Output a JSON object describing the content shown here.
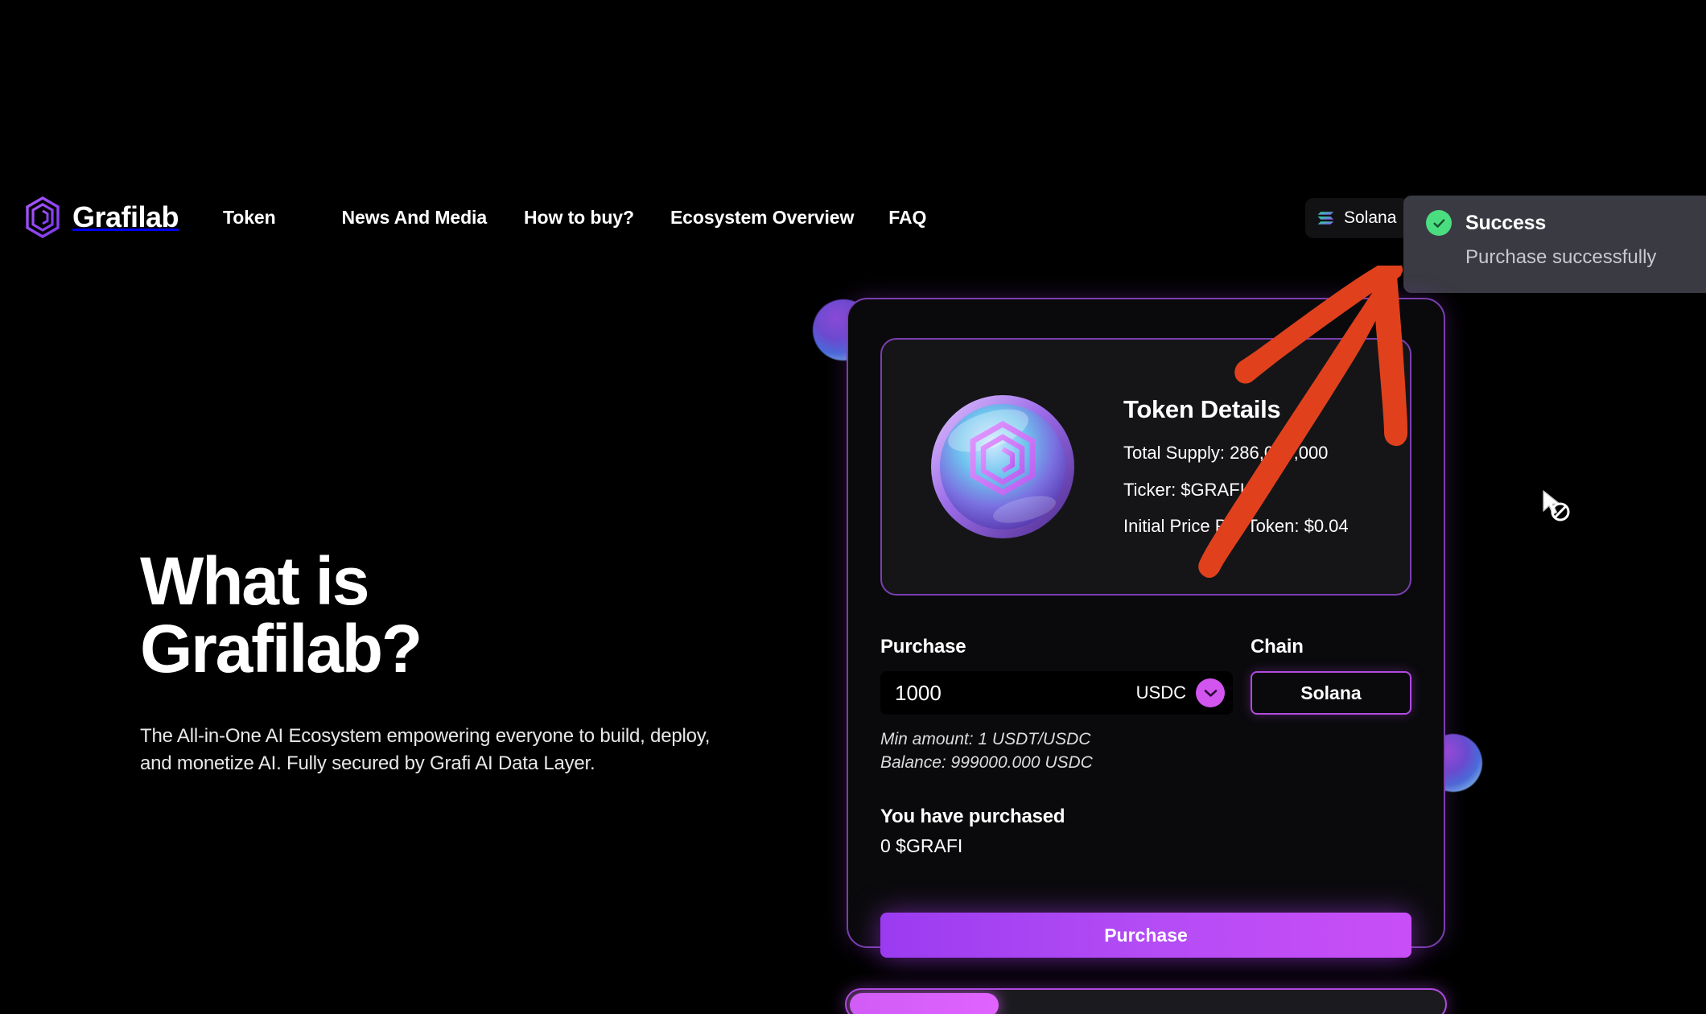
{
  "site": {
    "brand_name": "Grafilab",
    "logo_icon": "grafilab-hexagon-logo"
  },
  "nav": {
    "items": [
      {
        "label": "Token"
      },
      {
        "label": "News And Media"
      },
      {
        "label": "How to buy?"
      },
      {
        "label": "Ecosystem Overview"
      },
      {
        "label": "FAQ"
      }
    ]
  },
  "header_chain": {
    "label": "Solana",
    "icon": "solana-logo-icon"
  },
  "toast": {
    "icon": "check-circle-icon",
    "title": "Success",
    "message": "Purchase successfully",
    "accent_color": "#4ade80",
    "background_color": "#3a3a43"
  },
  "hero": {
    "heading_line1": "What is",
    "heading_line2": "Grafilab?",
    "paragraph": "The All-in-One AI Ecosystem empowering everyone to build, deploy, and monetize AI. Fully secured by Grafi AI Data Layer."
  },
  "token_card": {
    "coin_icon": "grafilab-token-coin",
    "title": "Token Details",
    "total_supply": "Total Supply: 286,000,000",
    "ticker": "Ticker: $GRAFI",
    "initial_price": "Initial Price Per Token: $0.04"
  },
  "purchase_form": {
    "purchase_label": "Purchase",
    "amount_value": "1000",
    "currency": "USDC",
    "currency_chevron_icon": "chevron-down-icon",
    "chain_label": "Chain",
    "chain_value": "Solana",
    "min_amount": "Min amount: 1 USDT/USDC",
    "balance": "Balance: 999000.000 USDC",
    "purchased_label": "You have purchased",
    "purchased_value": "0 $GRAFI",
    "submit_label": "Purchase"
  },
  "progress": {
    "percent": 25
  },
  "annotation": {
    "type": "hand-drawn-arrow",
    "color": "#e0411c",
    "points_to": "success-toast"
  },
  "cursor": {
    "type": "not-allowed"
  },
  "theme": {
    "background": "#000000",
    "accent_purple": "#b14ae0",
    "accent_magenta": "#d155ee",
    "card_border": "#7b3fb0"
  }
}
